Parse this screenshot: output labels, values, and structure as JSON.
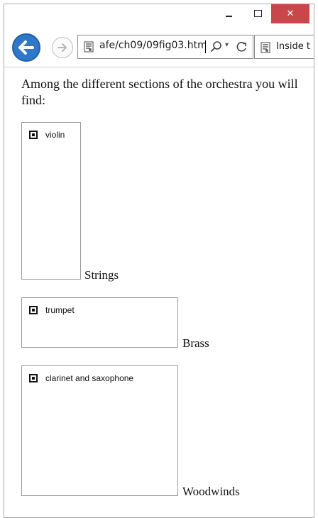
{
  "window": {
    "close_label": "✕"
  },
  "address_bar": {
    "url": "afe/ch09/09fig03.htm",
    "search_dropdown": "▾"
  },
  "tab": {
    "label": "Inside t"
  },
  "page": {
    "intro": "Among the different sections of the orchestra you will find:",
    "sections": [
      {
        "option": "violin",
        "label": "Strings"
      },
      {
        "option": "trumpet",
        "label": "Brass"
      },
      {
        "option": "clarinet and saxophone",
        "label": "Woodwinds"
      }
    ]
  }
}
